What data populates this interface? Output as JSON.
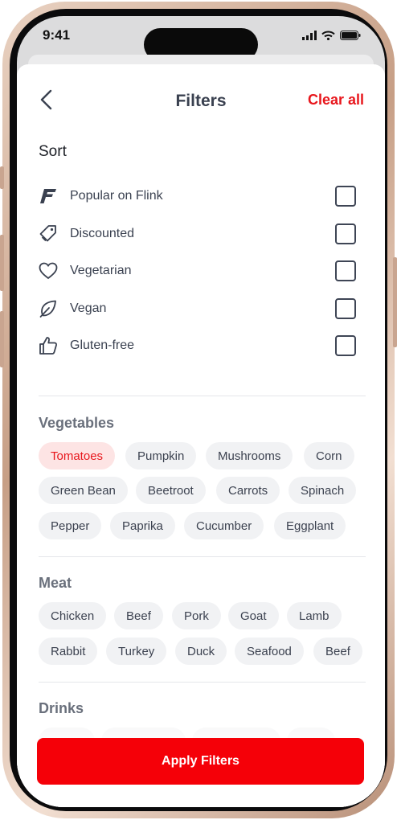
{
  "status": {
    "time": "9:41"
  },
  "header": {
    "title": "Filters",
    "clear_label": "Clear all"
  },
  "sort": {
    "title": "Sort",
    "items": [
      {
        "label": "Popular on Flink",
        "icon": "flink-logo-icon",
        "checked": false
      },
      {
        "label": "Discounted",
        "icon": "tag-icon",
        "checked": false
      },
      {
        "label": "Vegetarian",
        "icon": "heart-icon",
        "checked": false
      },
      {
        "label": "Vegan",
        "icon": "leaf-icon",
        "checked": false
      },
      {
        "label": "Gluten-free",
        "icon": "thumbs-up-icon",
        "checked": false
      }
    ]
  },
  "vegetables": {
    "title": "Vegetables",
    "chips": [
      "Tomatoes",
      "Pumpkin",
      "Mushrooms",
      "Corn",
      "Green Bean",
      "Beetroot",
      "Carrots",
      "Spinach",
      "Pepper",
      "Paprika",
      "Cucumber",
      "Eggplant"
    ],
    "selected": "Tomatoes"
  },
  "meat": {
    "title": "Meat",
    "chips": [
      "Chicken",
      "Beef",
      "Pork",
      "Goat",
      "Lamb",
      "Rabbit",
      "Turkey",
      "Duck",
      "Seafood",
      "Beef"
    ]
  },
  "drinks": {
    "title": "Drinks"
  },
  "footer": {
    "apply_label": "Apply Filters"
  },
  "colors": {
    "accent": "#f50008",
    "text": "#3a4150",
    "chip_bg": "#f1f2f4",
    "chip_selected_bg": "#fde4e4"
  }
}
